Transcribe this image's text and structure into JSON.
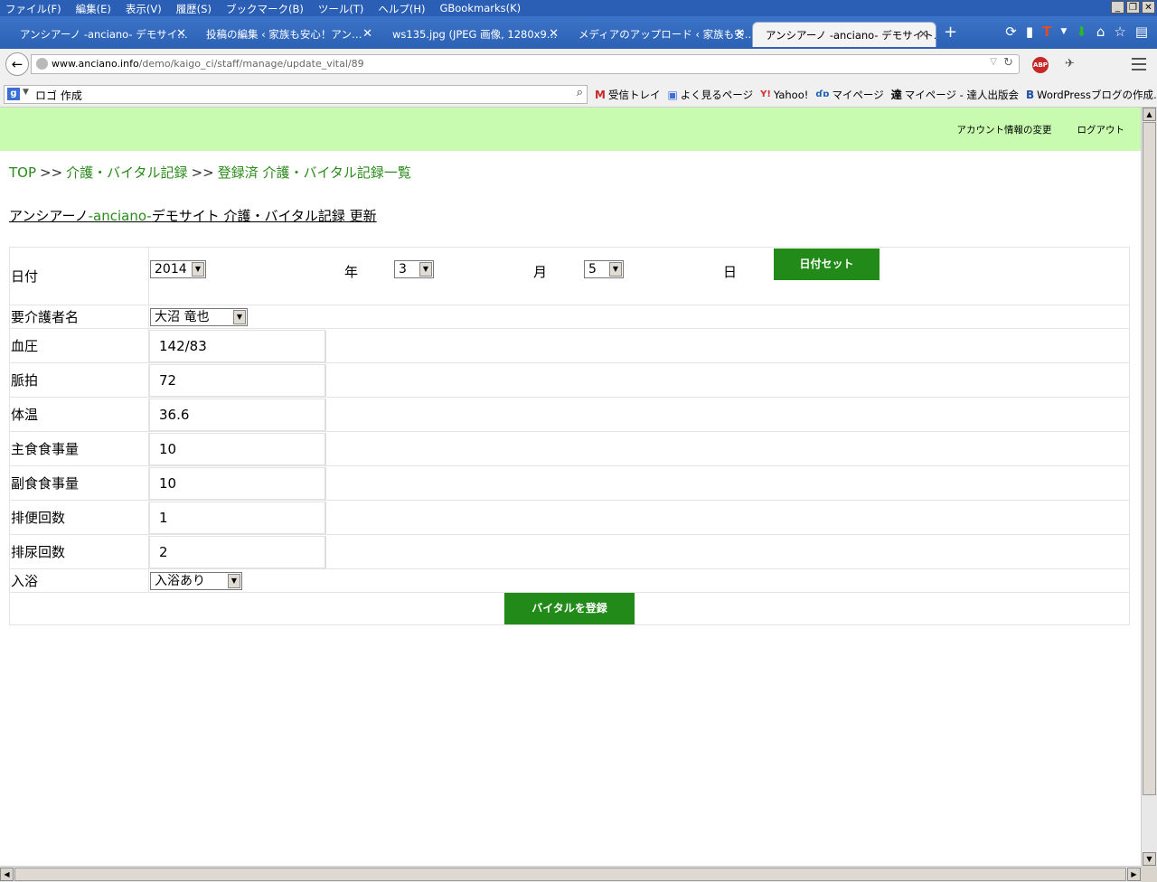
{
  "browser": {
    "menu": [
      "ファイル(F)",
      "編集(E)",
      "表示(V)",
      "履歴(S)",
      "ブックマーク(B)",
      "ツール(T)",
      "ヘルプ(H)",
      "GBookmarks(K)"
    ],
    "tabs": [
      {
        "label": "アンシアーノ -anciano- デモサイ…"
      },
      {
        "label": "投稿の編集 ‹ 家族も安心！アン…"
      },
      {
        "label": "ws135.jpg (JPEG 画像, 1280x9…"
      },
      {
        "label": "メディアのアップロード ‹ 家族も安…"
      },
      {
        "label": "アンシアーノ -anciano- デモサイト…"
      }
    ],
    "url_host": "www.anciano.info",
    "url_path": "/demo/kaigo_ci/staff/manage/update_vital/89",
    "search_query": "ロゴ 作成",
    "bookmarks": [
      {
        "label": "受信トレイ",
        "icon": "M"
      },
      {
        "label": "よく見るページ",
        "icon": "▣"
      },
      {
        "label": "Yahoo!",
        "icon": "Y!"
      },
      {
        "label": "マイページ",
        "icon": "ɗɒ"
      },
      {
        "label": "マイページ - 達人出版会",
        "icon": "達"
      },
      {
        "label": "WordPressブログの作成…",
        "icon": "B"
      }
    ]
  },
  "header": {
    "account_link": "アカウント情報の変更",
    "logout_link": "ログアウト"
  },
  "breadcrumb": {
    "top": "TOP",
    "sep": ">>",
    "level1": "介護・バイタル記録",
    "level2": "登録済 介護・バイタル記録一覧"
  },
  "title": {
    "prefix": "アンシアーノ",
    "brand": "-anciano-",
    "suffix": "デモサイト 介護・バイタル記録 更新"
  },
  "form": {
    "date_label": "日付",
    "year": "2014",
    "year_unit": "年",
    "month": "3",
    "month_unit": "月",
    "day": "5",
    "day_unit": "日",
    "date_set_button": "日付セット",
    "patient_label": "要介護者名",
    "patient": "大沼 竜也",
    "fields": [
      {
        "label": "血圧",
        "value": "142/83"
      },
      {
        "label": "脈拍",
        "value": "72"
      },
      {
        "label": "体温",
        "value": "36.6"
      },
      {
        "label": "主食食事量",
        "value": "10"
      },
      {
        "label": "副食食事量",
        "value": "10"
      },
      {
        "label": "排便回数",
        "value": "1"
      },
      {
        "label": "排尿回数",
        "value": "2"
      }
    ],
    "bath_label": "入浴",
    "bath": "入浴あり",
    "submit_button": "バイタルを登録"
  },
  "colors": {
    "header_bg": "#c8fbb0",
    "link_green": "#2a8a1a",
    "button_green": "#218a18",
    "tabbar_blue": "#2c61b4"
  }
}
